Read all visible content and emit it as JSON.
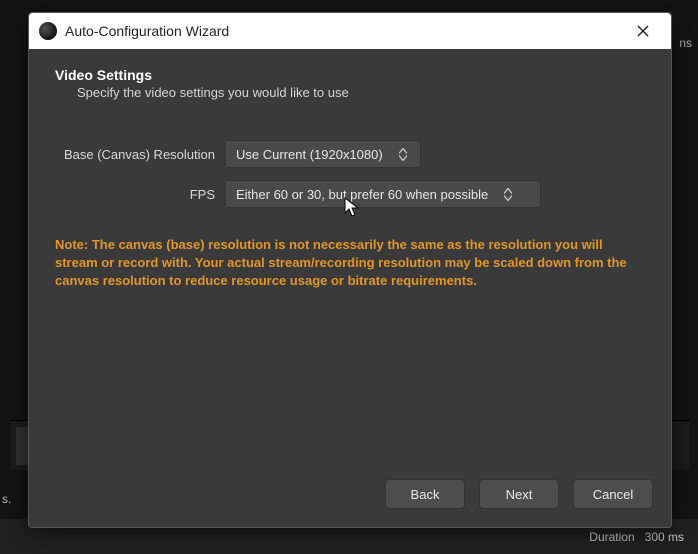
{
  "window": {
    "title": "Auto-Configuration Wizard"
  },
  "page": {
    "heading": "Video Settings",
    "subheading": "Specify the video settings you would like to use"
  },
  "form": {
    "resolution_label": "Base (Canvas) Resolution",
    "resolution_value": "Use Current (1920x1080)",
    "fps_label": "FPS",
    "fps_value": "Either 60 or 30, but prefer 60 when possible"
  },
  "note": "Note: The canvas (base) resolution is not necessarily the same as the resolution you will stream or record with. Your actual stream/recording resolution may be scaled down from the canvas resolution to reduce resource usage or bitrate requirements.",
  "buttons": {
    "back": "Back",
    "next": "Next",
    "cancel": "Cancel"
  },
  "statusbar": {
    "duration_label": "Duration",
    "duration_value": "300 ms"
  },
  "edge": {
    "left_fragment": "s.",
    "right_fragment": "ns"
  }
}
